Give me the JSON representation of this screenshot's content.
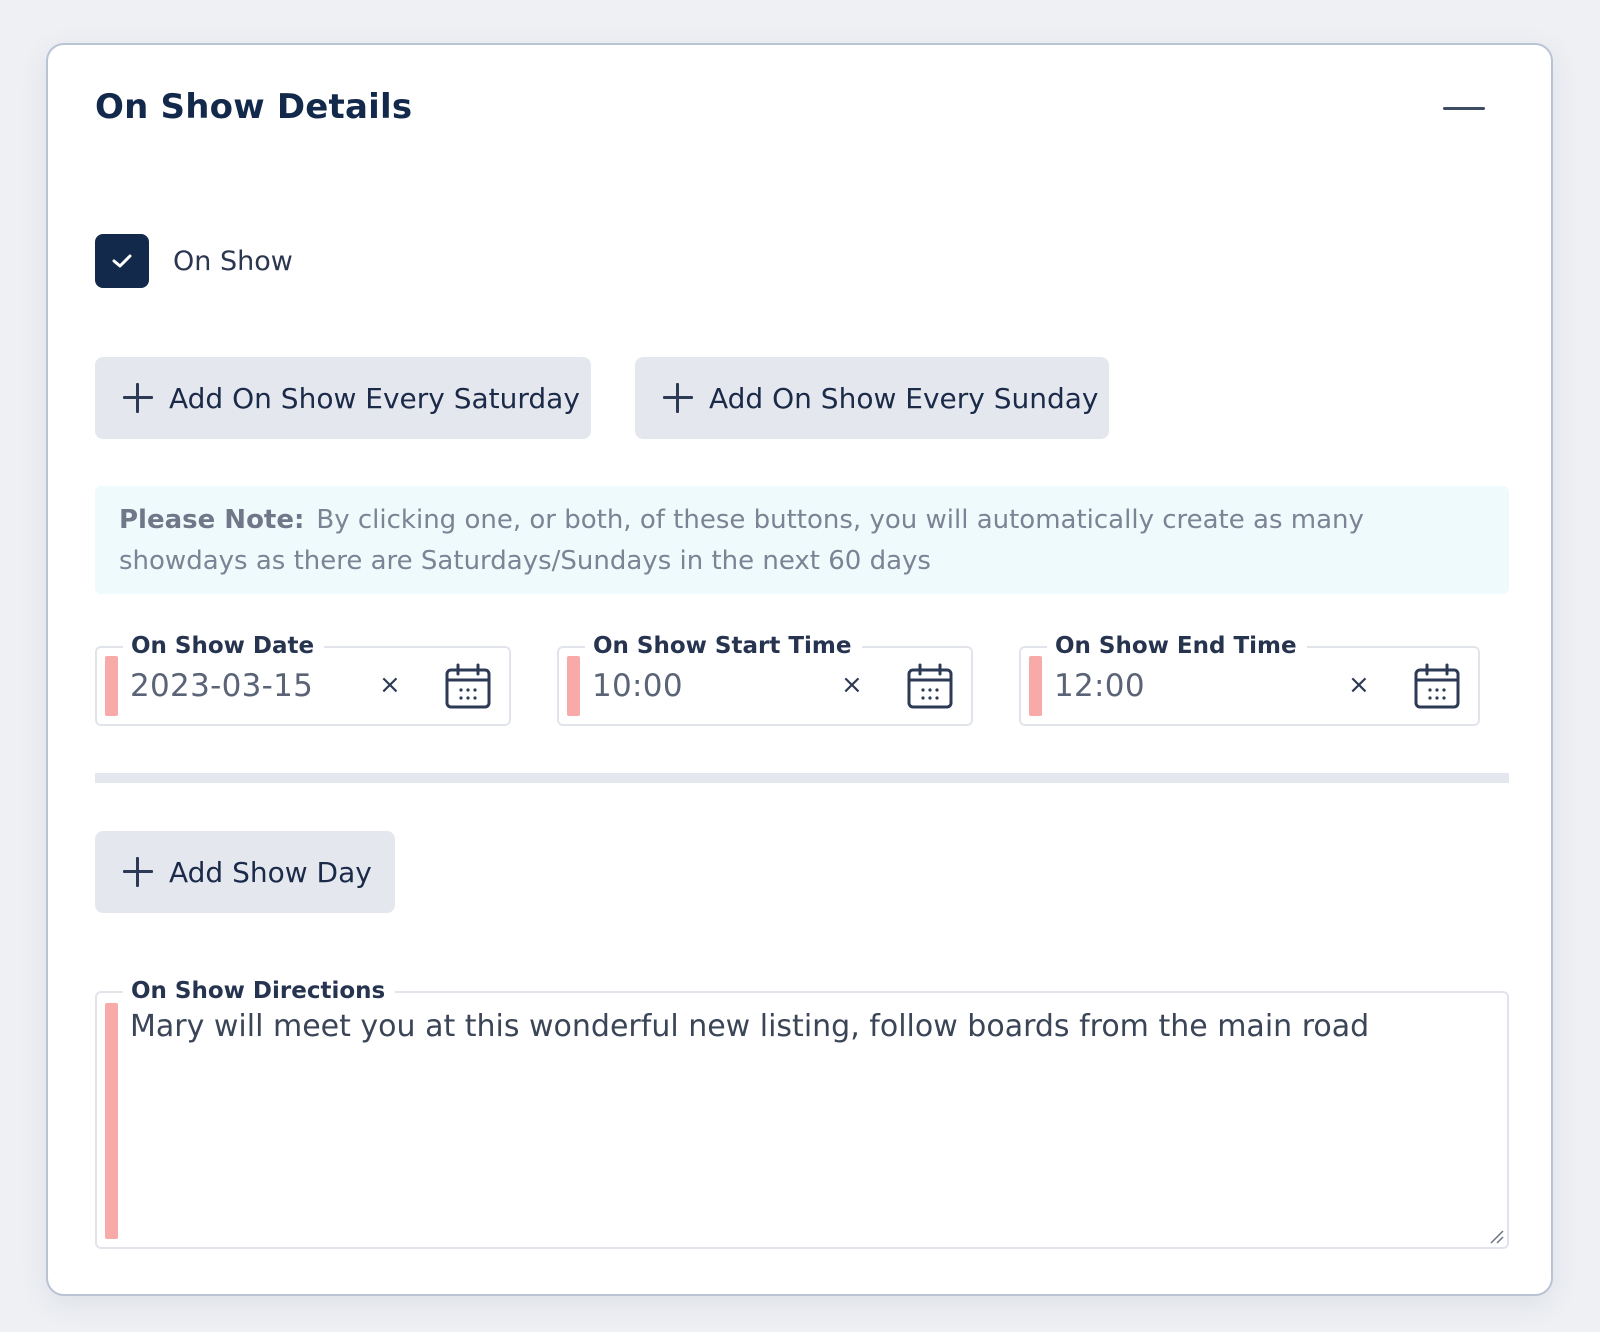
{
  "card": {
    "title": "On Show Details"
  },
  "on_show": {
    "label": "On Show",
    "checked": true
  },
  "buttons": {
    "add_saturday": "Add On Show Every Saturday",
    "add_sunday": "Add On Show Every Sunday",
    "add_show_day": "Add Show Day"
  },
  "note": {
    "label": "Please Note:",
    "text": "By clicking one, or both, of these buttons, you will automatically create as many showdays as there are Saturdays/Sundays in the next 60 days"
  },
  "fields": {
    "date": {
      "label": "On Show Date",
      "value": "2023-03-15"
    },
    "start_time": {
      "label": "On Show Start Time",
      "value": "10:00"
    },
    "end_time": {
      "label": "On Show End Time",
      "value": "12:00"
    }
  },
  "directions": {
    "label": "On Show Directions",
    "value": "Mary will meet you at this wonderful new listing, follow boards from the main road"
  },
  "icons": {
    "clear": "×",
    "calendar": "calendar-icon",
    "plus": "plus-icon",
    "collapse": "minus-icon",
    "check": "check-icon"
  },
  "colors": {
    "primary": "#13294b",
    "required_marker": "#f7aaa8",
    "button_bg": "#e4e8ee",
    "note_bg": "#eefafc"
  }
}
